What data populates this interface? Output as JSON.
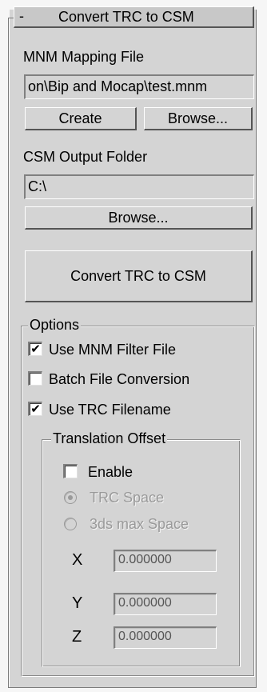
{
  "rollout": {
    "toggle": "-",
    "title": "Convert TRC to CSM"
  },
  "mapping": {
    "label": "MNM Mapping File",
    "path": "on\\Bip and Mocap\\test.mnm",
    "create_label": "Create",
    "browse_label": "Browse..."
  },
  "output": {
    "label": "CSM Output Folder",
    "path": "C:\\",
    "browse_label": "Browse..."
  },
  "convert_label": "Convert TRC to CSM",
  "options": {
    "label": "Options",
    "use_filter": {
      "label": "Use MNM Filter File",
      "checked": true,
      "mark": "✔"
    },
    "batch": {
      "label": "Batch File Conversion",
      "checked": false,
      "mark": ""
    },
    "use_trc_name": {
      "label": "Use TRC Filename",
      "checked": true,
      "mark": "✔"
    }
  },
  "translation": {
    "label": "Translation Offset",
    "enable": {
      "label": "Enable",
      "checked": false,
      "mark": ""
    },
    "trc_space": {
      "label": "TRC Space",
      "selected": true,
      "enabled": false
    },
    "max_space": {
      "label": "3ds max Space",
      "selected": false,
      "enabled": false
    },
    "x": {
      "label": "X",
      "value": "0.000000"
    },
    "y": {
      "label": "Y",
      "value": "0.000000"
    },
    "z": {
      "label": "Z",
      "value": "0.000000"
    }
  },
  "colors": {
    "panel": "#d4d4d4",
    "disabled_text": "#9a9a9a"
  }
}
